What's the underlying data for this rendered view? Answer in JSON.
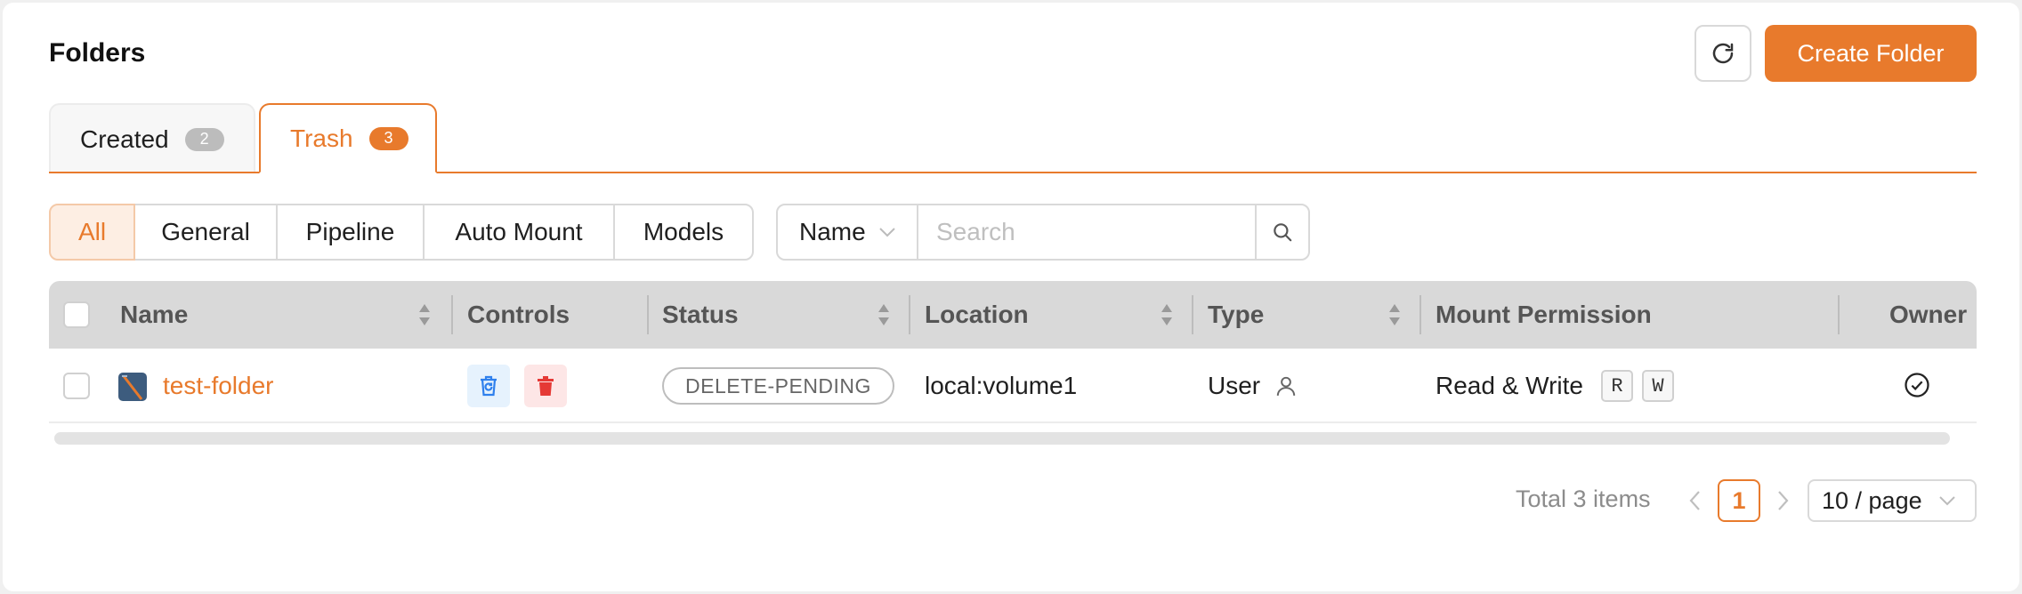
{
  "header": {
    "title": "Folders",
    "create_label": "Create Folder",
    "refresh_icon": "refresh-icon"
  },
  "tabs": [
    {
      "label": "Created",
      "count": "2",
      "active": false
    },
    {
      "label": "Trash",
      "count": "3",
      "active": true
    }
  ],
  "filters": {
    "segments": [
      "All",
      "General",
      "Pipeline",
      "Auto Mount",
      "Models"
    ],
    "active": "All",
    "search_field": "Name",
    "search_placeholder": "Search"
  },
  "table": {
    "columns": [
      "Name",
      "Controls",
      "Status",
      "Location",
      "Type",
      "Mount Permission",
      "Owner"
    ],
    "rows": [
      {
        "name": "test-folder",
        "status": "DELETE-PENDING",
        "location": "local:volume1",
        "type": "User",
        "permission": "Read & Write",
        "perm_flags": [
          "R",
          "W"
        ],
        "owner": true
      }
    ]
  },
  "pagination": {
    "total": "Total 3 items",
    "current_page": "1",
    "page_size": "10 / page"
  },
  "colors": {
    "accent": "#e87a2c",
    "restore": "#2f80ed",
    "delete": "#e53935"
  }
}
